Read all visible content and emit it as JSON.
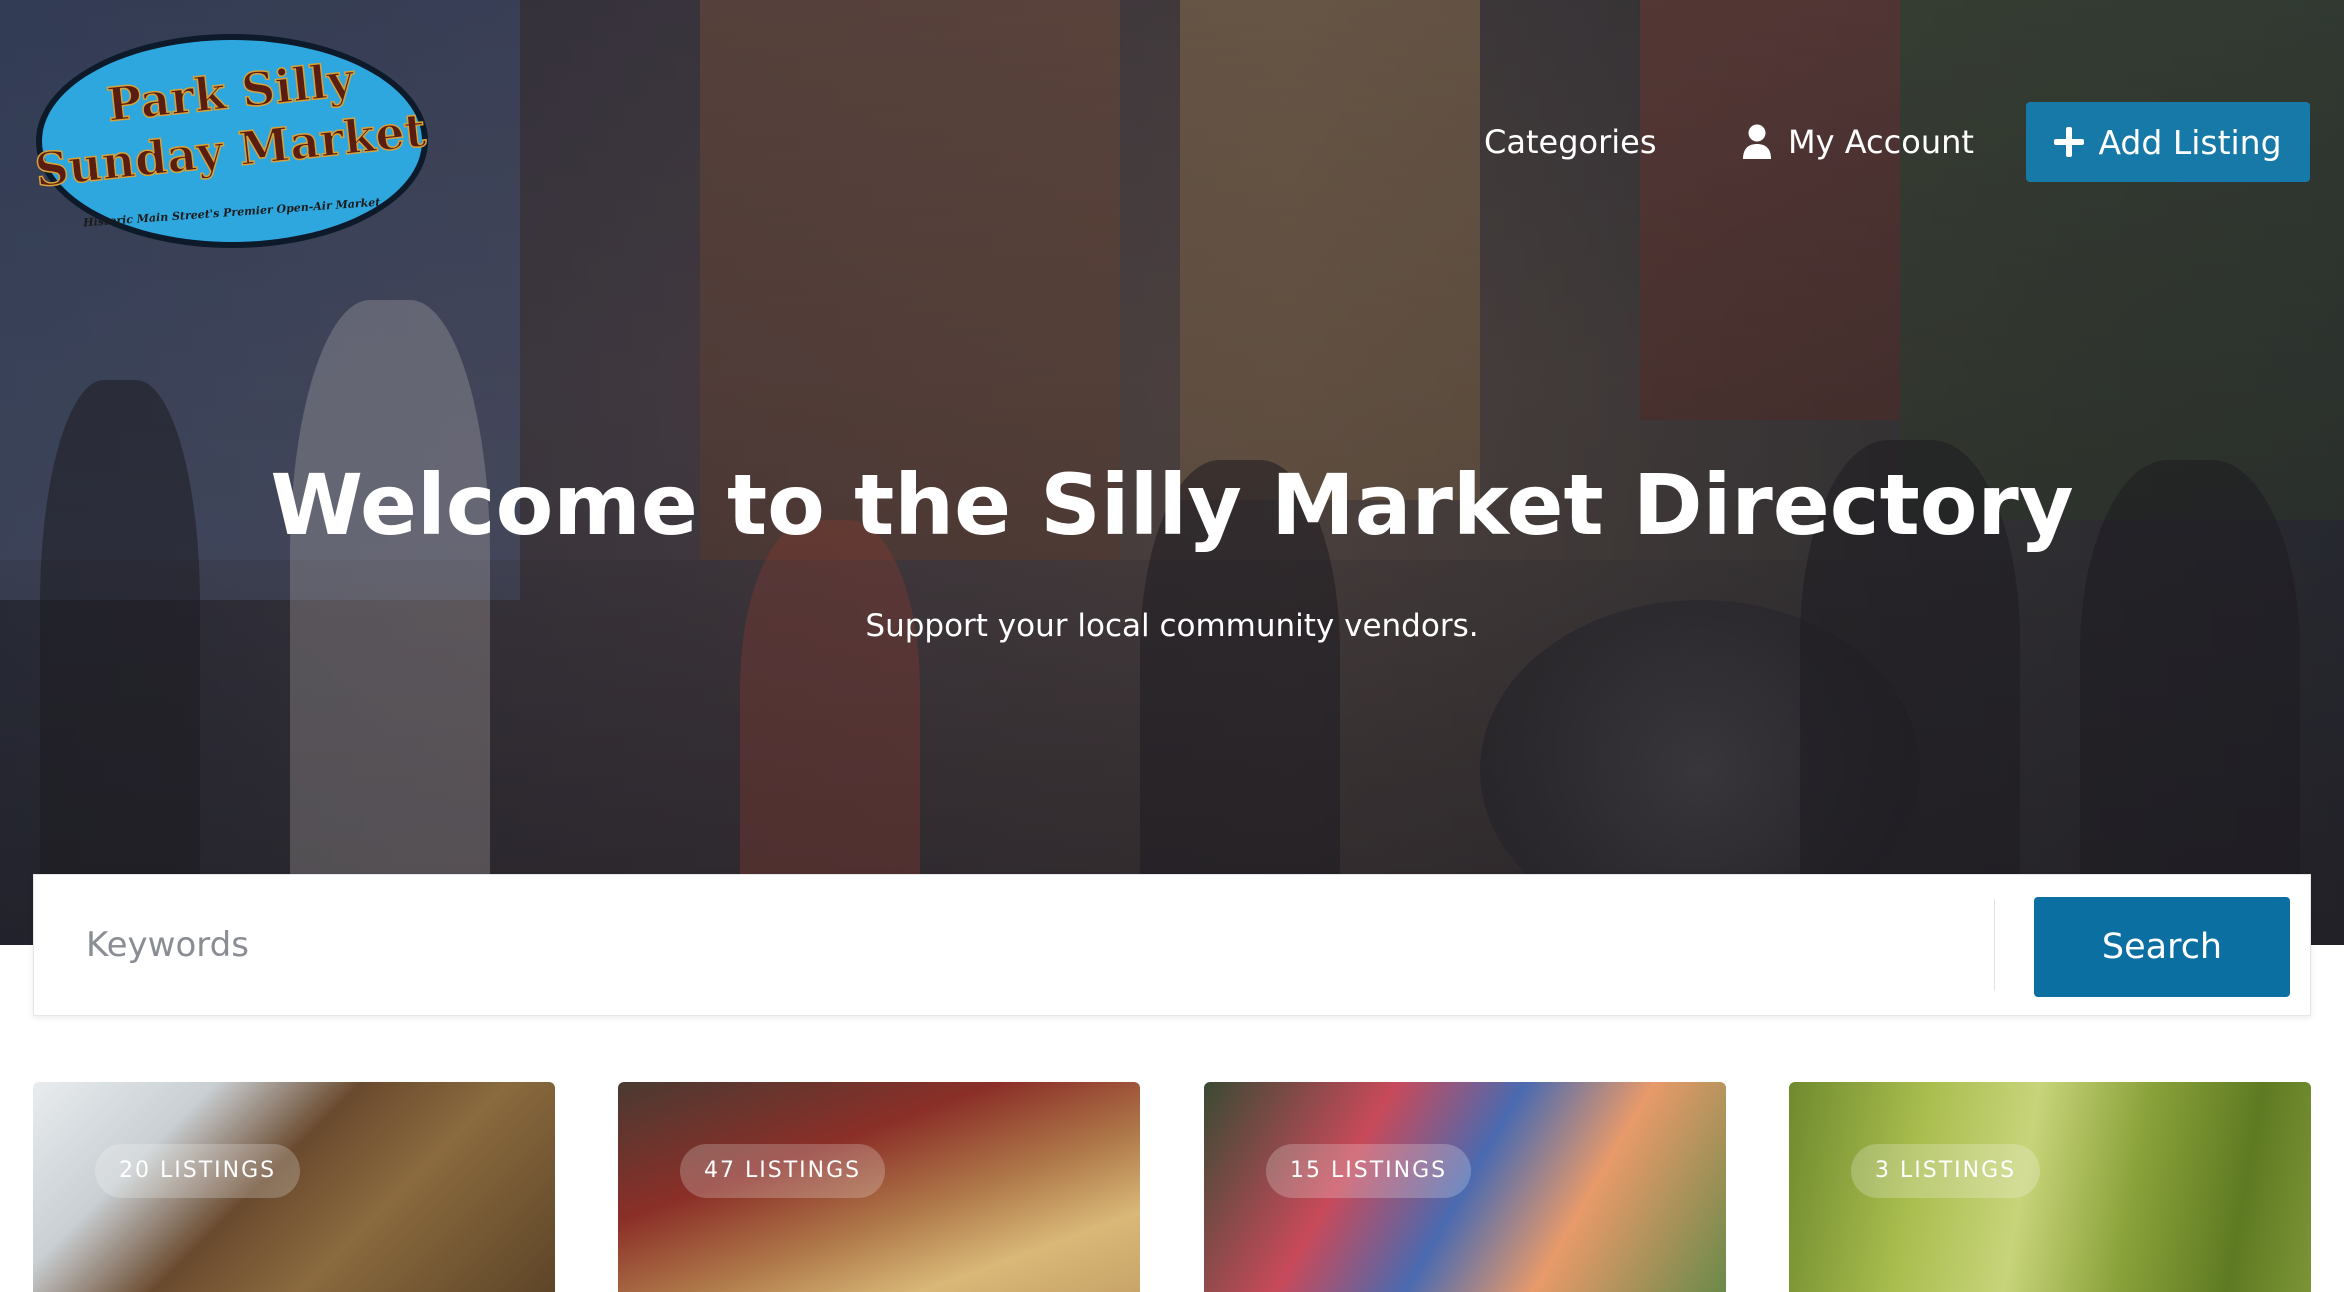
{
  "logo": {
    "line1": "Park Silly",
    "line2": "Sunday Market",
    "tagline": "Historic Main Street's Premier Open-Air Market",
    "colors": {
      "oval": "#2ea7df",
      "text": "#5a1e10",
      "outline": "#d8a23a"
    }
  },
  "nav": {
    "categories_label": "Categories",
    "account_label": "My Account",
    "account_icon": "user-icon",
    "add_listing_label": "Add Listing",
    "add_listing_icon": "plus-icon"
  },
  "hero": {
    "title": "Welcome to the Silly Market Directory",
    "subtitle": "Support your local community vendors."
  },
  "search": {
    "placeholder": "Keywords",
    "value": "",
    "button_label": "Search"
  },
  "categories": [
    {
      "listings": "20 LISTINGS"
    },
    {
      "listings": "47 LISTINGS"
    },
    {
      "listings": "15 LISTINGS"
    },
    {
      "listings": "3 LISTINGS"
    }
  ],
  "colors": {
    "primary_button": "#1779a8",
    "search_button": "#0c6fa1",
    "text_light": "#ffffff"
  }
}
